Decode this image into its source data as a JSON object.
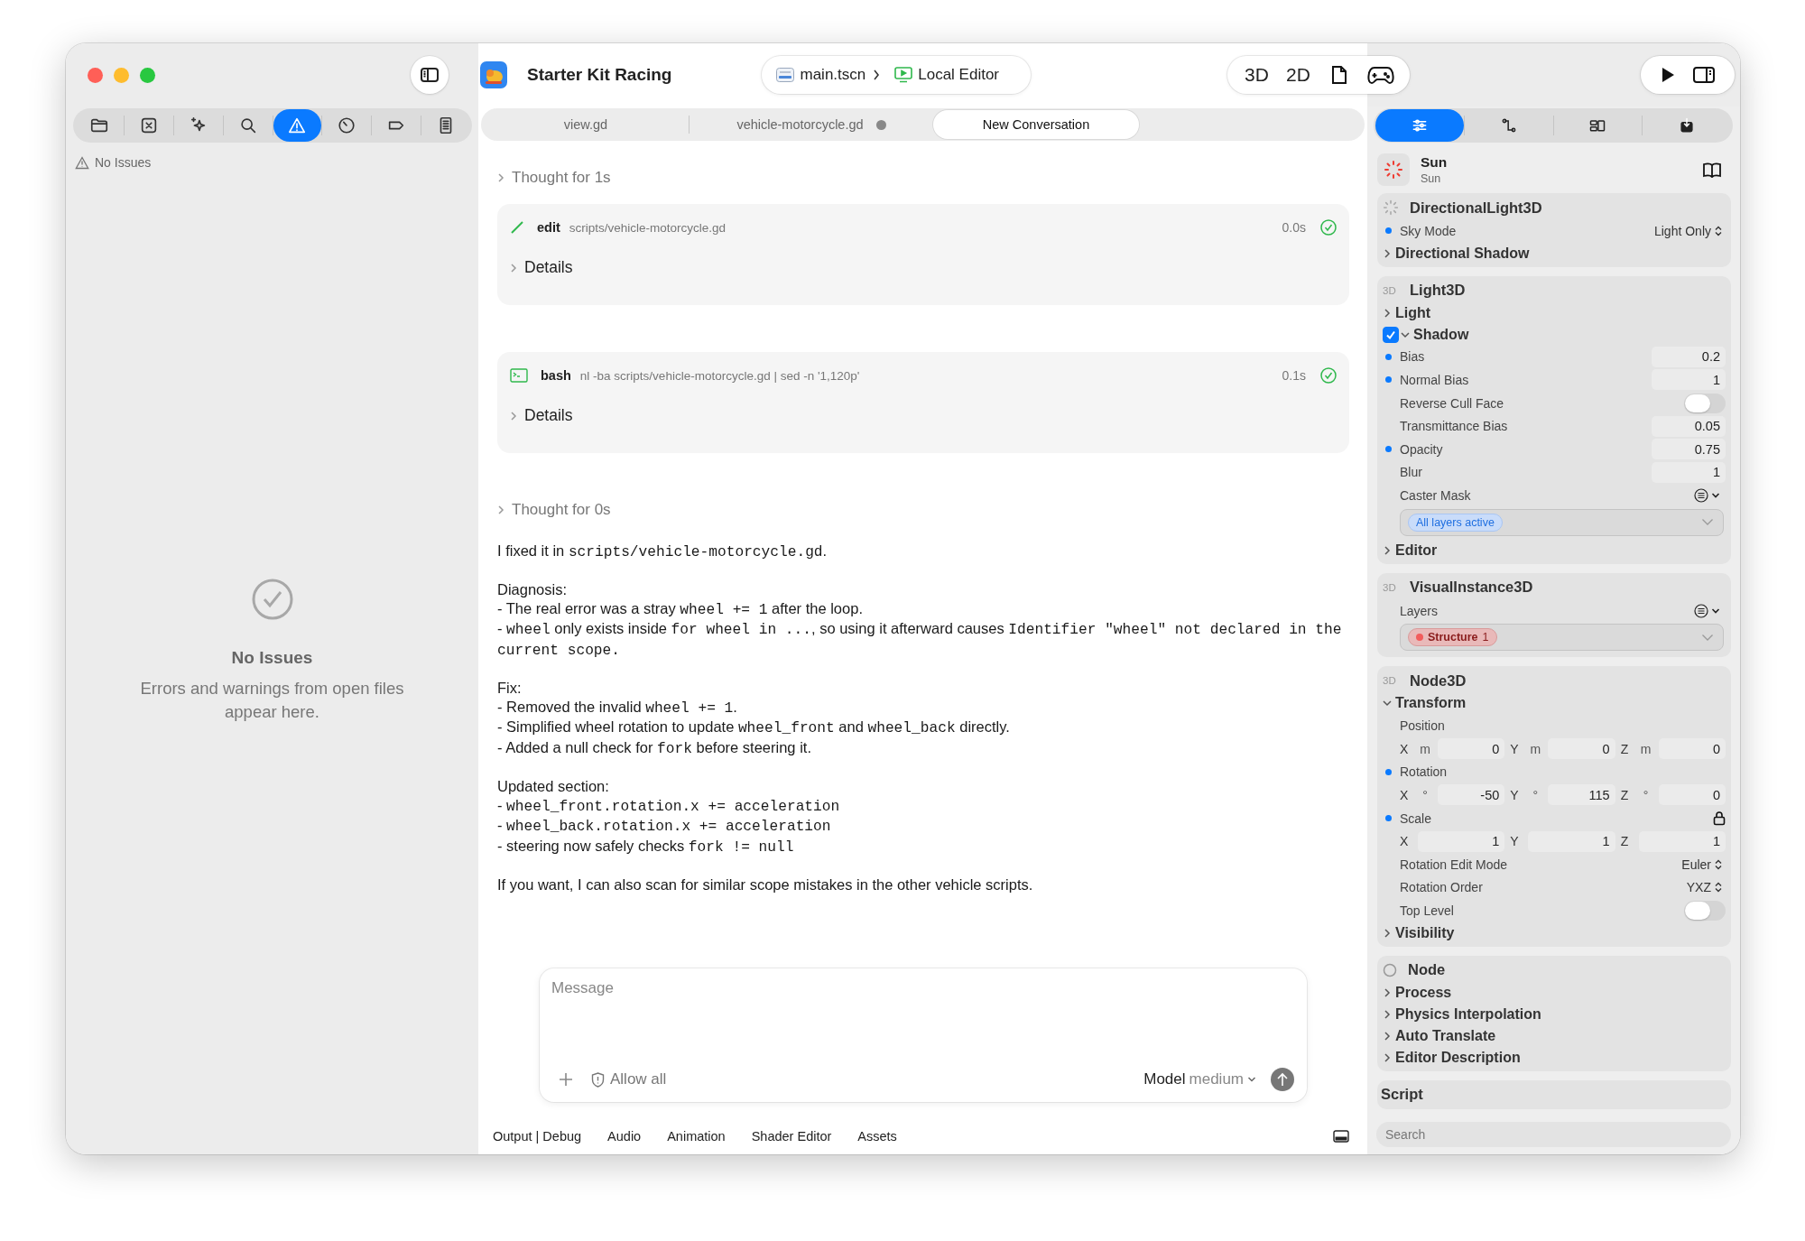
{
  "window": {
    "title": "Starter Kit Racing"
  },
  "scene_path": {
    "scene": "main.tscn",
    "target": "Local Editor"
  },
  "view_switcher": [
    "3D",
    "2D"
  ],
  "navigator": {
    "tabs": [
      {
        "selected": false
      },
      {
        "selected": false
      },
      {
        "selected": false
      },
      {
        "selected": false
      },
      {
        "selected": true
      },
      {
        "selected": false
      },
      {
        "selected": false
      },
      {
        "selected": false
      }
    ],
    "status": "No Issues",
    "empty_title": "No Issues",
    "empty_message": "Errors and warnings from open files appear here."
  },
  "editor_tabs": [
    {
      "label": "view.gd",
      "selected": false,
      "modified": false
    },
    {
      "label": "vehicle-motorcycle.gd",
      "selected": false,
      "modified": true
    },
    {
      "label": "New Conversation",
      "selected": true,
      "modified": false
    }
  ],
  "chat": [
    {
      "kind": "thought",
      "label": "Thought for 1s"
    },
    {
      "kind": "edit",
      "tool": "edit",
      "command": "scripts/vehicle-motorcycle.gd",
      "duration": "0.0s",
      "done": true,
      "details": "Details"
    },
    {
      "kind": "bash",
      "tool": "bash",
      "command": "nl -ba scripts/vehicle-motorcycle.gd | sed -n '1,120p'",
      "duration": "0.1s",
      "done": true,
      "details": "Details"
    },
    {
      "kind": "thought",
      "label": "Thought for 0s"
    },
    {
      "kind": "message",
      "paragraphs": [
        [
          [
            {
              "text": "I fixed it in ",
              "code": false
            },
            {
              "text": "scripts/vehicle-motorcycle.gd",
              "code": true
            },
            {
              "text": ".",
              "code": false
            }
          ]
        ],
        [
          [
            {
              "text": "Diagnosis:",
              "code": false
            }
          ],
          [
            {
              "text": "- The real error was a stray ",
              "code": false
            },
            {
              "text": "wheel += 1",
              "code": true
            },
            {
              "text": " after the loop.",
              "code": false
            }
          ],
          [
            {
              "text": "- ",
              "code": false
            },
            {
              "text": "wheel",
              "code": true
            },
            {
              "text": " only exists inside ",
              "code": false
            },
            {
              "text": "for wheel in ...",
              "code": true
            },
            {
              "text": ", so using it afterward causes ",
              "code": false
            },
            {
              "text": "Identifier \"wheel\" not declared in the current scope.",
              "code": true
            }
          ]
        ],
        [
          [
            {
              "text": "Fix:",
              "code": false
            }
          ],
          [
            {
              "text": "- Removed the invalid ",
              "code": false
            },
            {
              "text": "wheel += 1",
              "code": true
            },
            {
              "text": ".",
              "code": false
            }
          ],
          [
            {
              "text": "- Simplified wheel rotation to update ",
              "code": false
            },
            {
              "text": "wheel_front",
              "code": true
            },
            {
              "text": " and ",
              "code": false
            },
            {
              "text": "wheel_back",
              "code": true
            },
            {
              "text": " directly.",
              "code": false
            }
          ],
          [
            {
              "text": "- Added a null check for ",
              "code": false
            },
            {
              "text": "fork",
              "code": true
            },
            {
              "text": " before steering it.",
              "code": false
            }
          ]
        ],
        [
          [
            {
              "text": "Updated section:",
              "code": false
            }
          ],
          [
            {
              "text": "- ",
              "code": false
            },
            {
              "text": "wheel_front.rotation.x += acceleration",
              "code": true
            }
          ],
          [
            {
              "text": "- ",
              "code": false
            },
            {
              "text": "wheel_back.rotation.x += acceleration",
              "code": true
            }
          ],
          [
            {
              "text": "- steering now safely checks ",
              "code": false
            },
            {
              "text": "fork != null",
              "code": true
            }
          ]
        ],
        [
          [
            {
              "text": "If you want, I can also scan for similar scope mistakes in the other vehicle scripts.",
              "code": false
            }
          ]
        ]
      ]
    }
  ],
  "composer": {
    "placeholder": "Message",
    "permission": "Allow all",
    "model_label": "Model",
    "model_value": "medium"
  },
  "bottom_tabs": [
    "Output | Debug",
    "Audio",
    "Animation",
    "Shader Editor",
    "Assets"
  ],
  "inspector": {
    "tabs": [
      {
        "selected": true
      },
      {
        "selected": false
      },
      {
        "selected": false
      },
      {
        "selected": false
      }
    ],
    "node_name": "Sun",
    "node_type": "Sun",
    "sections": [
      {
        "kind": "sun",
        "title": "DirectionalLight3D",
        "rows": [
          {
            "kind": "enum",
            "label": "Sky Mode",
            "value": "Light Only",
            "modified": true
          },
          {
            "kind": "group",
            "label": "Directional Shadow",
            "expanded": false
          }
        ]
      },
      {
        "kind": "badge",
        "badge": "3D",
        "title": "Light3D",
        "rows": [
          {
            "kind": "group",
            "label": "Light",
            "expanded": false
          },
          {
            "kind": "checkgroup",
            "label": "Shadow",
            "expanded": true,
            "checked": true
          },
          {
            "kind": "number",
            "label": "Bias",
            "value": "0.2",
            "modified": true
          },
          {
            "kind": "number",
            "label": "Normal Bias",
            "value": "1",
            "modified": true
          },
          {
            "kind": "toggle",
            "label": "Reverse Cull Face",
            "on": false
          },
          {
            "kind": "number",
            "label": "Transmittance Bias",
            "value": "0.05",
            "modified": false
          },
          {
            "kind": "number",
            "label": "Opacity",
            "value": "0.75",
            "modified": true
          },
          {
            "kind": "number",
            "label": "Blur",
            "value": "1",
            "modified": false
          },
          {
            "kind": "layers",
            "label": "Caster Mask",
            "chips": [
              {
                "kind": "summary",
                "label": "All layers active"
              }
            ]
          },
          {
            "kind": "group",
            "label": "Editor",
            "expanded": false
          }
        ]
      },
      {
        "kind": "badge",
        "badge": "3D",
        "title": "VisualInstance3D",
        "rows": [
          {
            "kind": "layers",
            "label": "Layers",
            "chips": [
              {
                "kind": "layer",
                "label": "Structure",
                "count": "1",
                "color": "#f25c5c"
              }
            ]
          }
        ]
      },
      {
        "kind": "badge",
        "badge": "3D",
        "title": "Node3D",
        "rows": [
          {
            "kind": "group",
            "label": "Transform",
            "expanded": true
          },
          {
            "kind": "vector",
            "label": "Position",
            "modified": false,
            "locked": false,
            "components": [
              {
                "axis": "X",
                "unit": "m",
                "value": "0"
              },
              {
                "axis": "Y",
                "unit": "m",
                "value": "0"
              },
              {
                "axis": "Z",
                "unit": "m",
                "value": "0"
              }
            ]
          },
          {
            "kind": "vector",
            "label": "Rotation",
            "modified": true,
            "locked": false,
            "components": [
              {
                "axis": "X",
                "unit": "°",
                "value": "-50"
              },
              {
                "axis": "Y",
                "unit": "°",
                "value": "115"
              },
              {
                "axis": "Z",
                "unit": "°",
                "value": "0"
              }
            ]
          },
          {
            "kind": "vector",
            "label": "Scale",
            "modified": true,
            "locked": true,
            "components": [
              {
                "axis": "X",
                "value": "1"
              },
              {
                "axis": "Y",
                "value": "1"
              },
              {
                "axis": "Z",
                "value": "1"
              }
            ]
          },
          {
            "kind": "enum",
            "label": "Rotation Edit Mode",
            "value": "Euler",
            "modified": false
          },
          {
            "kind": "enum",
            "label": "Rotation Order",
            "value": "YXZ",
            "modified": false
          },
          {
            "kind": "toggle",
            "label": "Top Level",
            "on": false
          },
          {
            "kind": "group",
            "label": "Visibility",
            "expanded": false
          }
        ]
      },
      {
        "kind": "circle",
        "title": "Node",
        "rows": [
          {
            "kind": "group",
            "label": "Process",
            "expanded": false
          },
          {
            "kind": "group",
            "label": "Physics Interpolation",
            "expanded": false
          },
          {
            "kind": "group",
            "label": "Auto Translate",
            "expanded": false
          },
          {
            "kind": "group",
            "label": "Editor Description",
            "expanded": false
          }
        ]
      },
      {
        "kind": "plain",
        "title": "Script"
      }
    ],
    "search": {
      "placeholder": "Search"
    }
  }
}
